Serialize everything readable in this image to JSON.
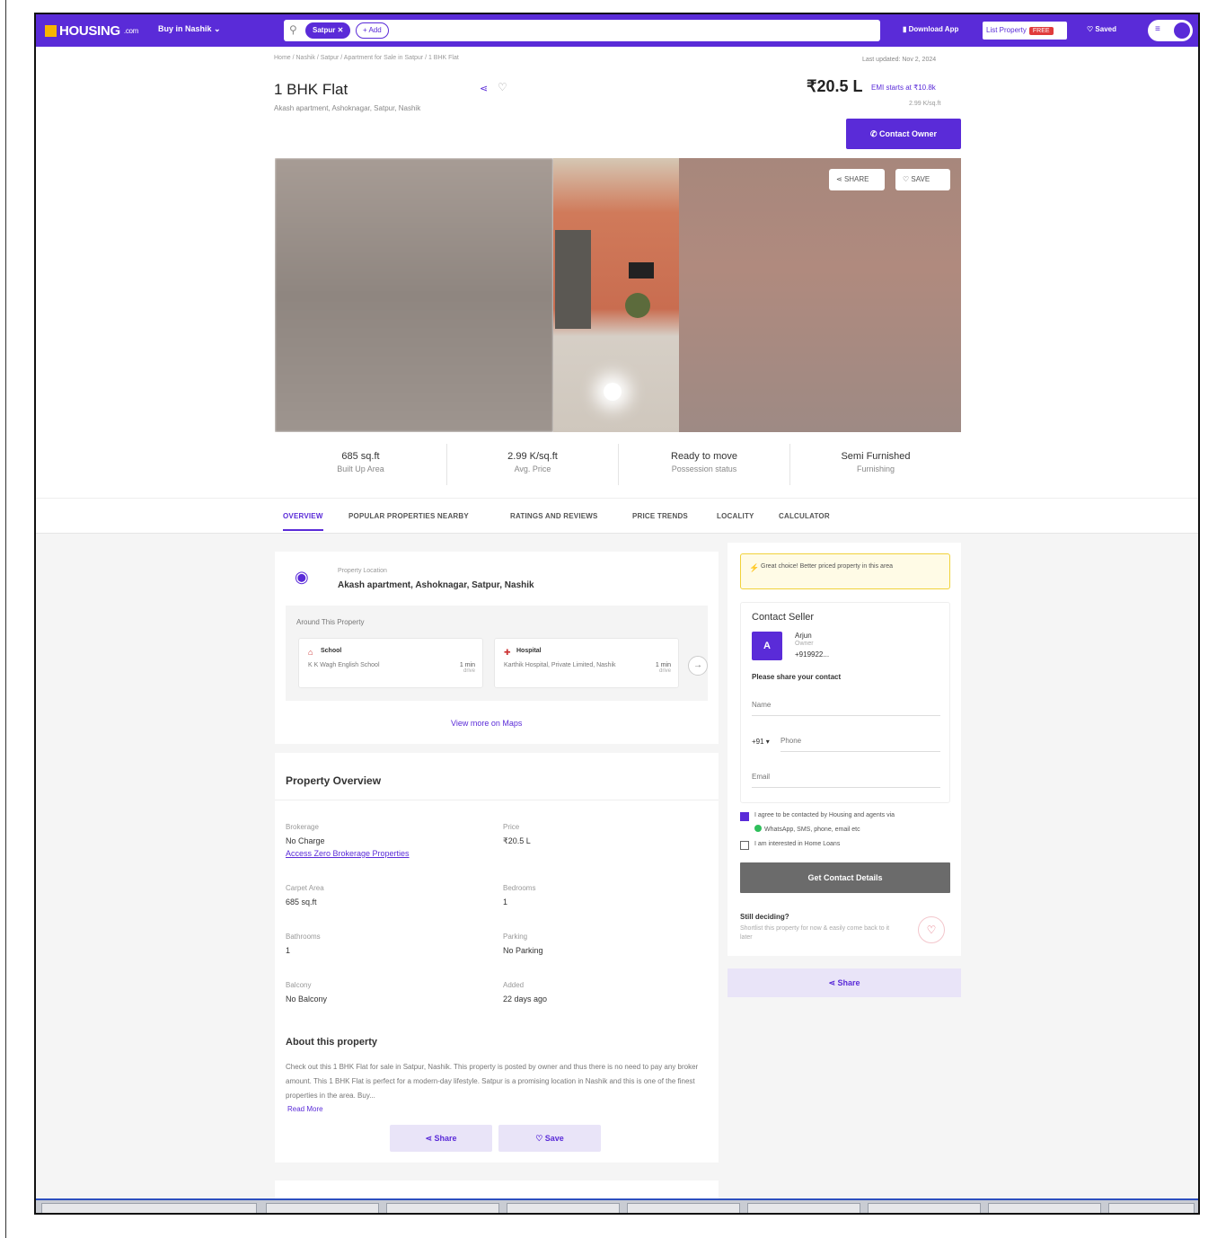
{
  "header": {
    "logo": "HOUSING",
    "logo_domain": ".com",
    "city_menu": "Buy in Nashik",
    "search_chip": "Satpur",
    "search_add": "+ Add",
    "download_app": "Download App",
    "list_property": "List Property",
    "list_badge": "FREE",
    "saved": "Saved",
    "brand_color": "#5a2bd8"
  },
  "breadcrumb": "Home / Nashik / Satpur / Apartment for Sale in Satpur / 1 BHK Flat",
  "last_updated": "Last updated: Nov 2, 2024",
  "property": {
    "title": "1 BHK Flat",
    "address": "Akash apartment, Ashoknagar, Satpur, Nashik",
    "price": "₹20.5 L",
    "emi": "EMI starts at ₹10.8k",
    "price_per_sqft": "2.99 K/sq.ft",
    "contact_owner": "Contact Owner",
    "share": "SHARE",
    "save": "SAVE"
  },
  "stats": [
    {
      "value": "685 sq.ft",
      "label": "Built Up Area"
    },
    {
      "value": "2.99 K/sq.ft",
      "label": "Avg. Price"
    },
    {
      "value": "Ready to move",
      "label": "Possession status"
    },
    {
      "value": "Semi Furnished",
      "label": "Furnishing"
    }
  ],
  "tabs": [
    "OVERVIEW",
    "POPULAR PROPERTIES NEARBY",
    "RATINGS AND REVIEWS",
    "PRICE TRENDS",
    "LOCALITY",
    "CALCULATOR"
  ],
  "location": {
    "label": "Property Location",
    "address": "Akash apartment, Ashoknagar, Satpur, Nashik",
    "around_title": "Around This Property",
    "pois": [
      {
        "category": "School",
        "name": "K K Wagh English School",
        "time": "1 min",
        "mode": "drive"
      },
      {
        "category": "Hospital",
        "name": "Karthik Hospital, Private Limited, Nashik",
        "time": "1 min",
        "mode": "drive"
      }
    ],
    "view_more": "View more on Maps"
  },
  "overview": {
    "heading": "Property Overview",
    "fields": [
      {
        "key": "Brokerage",
        "value": "No Charge",
        "link": "Access Zero Brokerage Properties"
      },
      {
        "key": "Price",
        "value": "₹20.5 L"
      },
      {
        "key": "Carpet Area",
        "value": "685 sq.ft"
      },
      {
        "key": "Bedrooms",
        "value": "1"
      },
      {
        "key": "Bathrooms",
        "value": "1"
      },
      {
        "key": "Parking",
        "value": "No Parking"
      },
      {
        "key": "Balcony",
        "value": "No Balcony"
      },
      {
        "key": "Added",
        "value": "22 days ago"
      }
    ],
    "about_heading": "About this property",
    "about_text": "Check out this 1 BHK Flat for sale in Satpur, Nashik. This property is posted by owner and thus there is no need to pay any broker amount. This 1 BHK Flat is perfect for a modern-day lifestyle. Satpur is a promising location in Nashik and this is one of the finest properties in the area. Buy...",
    "read_more": "Read More",
    "share_btn": "Share",
    "save_btn": "Save"
  },
  "contact": {
    "alert": "Great choice! Better priced property in this area",
    "title": "Contact Seller",
    "avatar_letter": "A",
    "seller_name": "Arjun",
    "seller_role": "Owner",
    "seller_phone": "+919922...",
    "share_prompt": "Please share your contact",
    "name_placeholder": "Name",
    "country_code": "+91 ▾",
    "phone_placeholder": "Phone",
    "email_placeholder": "Email",
    "agree": "I agree to be contacted by Housing and agents via",
    "whatsapp": "WhatsApp, SMS, phone, email etc",
    "home_loans": "I am interested in Home Loans",
    "get_contact": "Get Contact Details",
    "still_deciding": "Still deciding?",
    "shortlist": "Shortlist this property for now & easily come back to it later",
    "share": "Share"
  }
}
